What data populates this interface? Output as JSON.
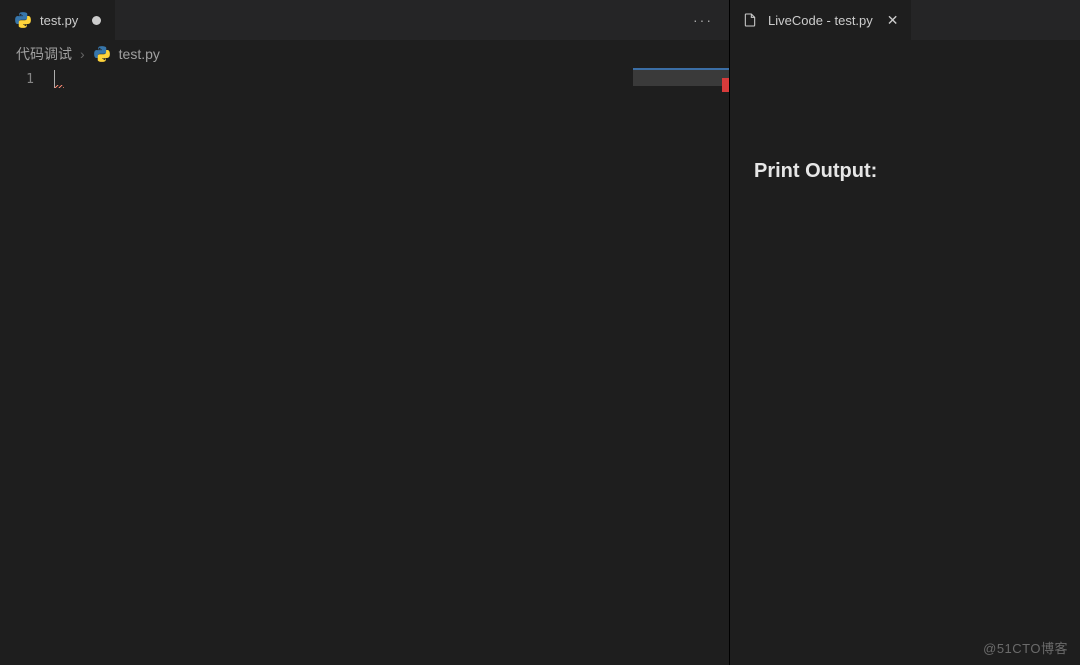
{
  "editor": {
    "tab": {
      "filename": "test.py",
      "dirty": true
    },
    "breadcrumb": {
      "folder": "代码调试",
      "file": "test.py"
    },
    "gutter": {
      "line": "1"
    },
    "actions": {
      "more": "···"
    }
  },
  "livePanel": {
    "tab": {
      "title": "LiveCode - test.py",
      "close": "✕"
    },
    "heading": "Print Output:"
  },
  "watermark": "@51CTO博客"
}
